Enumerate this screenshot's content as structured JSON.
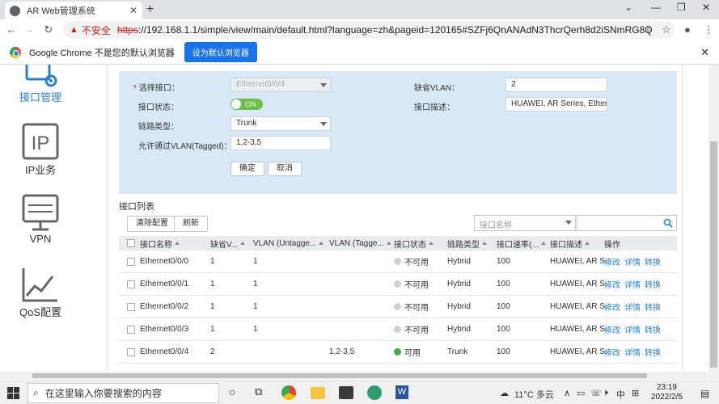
{
  "browser": {
    "tab_title": "AR Web管理系统",
    "insecure_label": "不安全",
    "url_scheme": "https",
    "url_rest": "://192.168.1.1/simple/view/main/default.html?language=zh&pageid=120165#SZFj6QnANAdN3ThcrQerh8d2iSNmRG8Q",
    "infobar_message": "Google Chrome 不是您的默认浏览器",
    "infobar_button": "设为默认浏览器"
  },
  "leftnav": {
    "items": [
      {
        "label": "接口管理",
        "icon": "interface-icon"
      },
      {
        "label": "IP业务",
        "icon": "ip-icon"
      },
      {
        "label": "VPN",
        "icon": "vpn-icon"
      },
      {
        "label": "QoS配置",
        "icon": "qos-icon"
      }
    ]
  },
  "form": {
    "interface_label": "选择接口：",
    "interface_value": "Ethernet0/0/4",
    "status_label": "接口状态：",
    "status_value": "ON",
    "link_type_label": "链路类型：",
    "link_type_value": "Trunk",
    "allowed_vlan_label": "允许通过VLAN(Tagged)：",
    "allowed_vlan_value": "1,2-3,5",
    "default_vlan_label": "缺省VLAN：",
    "default_vlan_value": "2",
    "description_label": "接口描述：",
    "description_value": "HUAWEI, AR Series, Ethernet",
    "ok_button": "确定",
    "cancel_button": "取消"
  },
  "list": {
    "title": "接口列表",
    "clear_button": "清除配置",
    "refresh_button": "刷新",
    "search_placeholder": "接口名称",
    "columns": [
      "接口名称",
      "缺省V...",
      "VLAN (Untagge...",
      "VLAN (Tagge...",
      "接口状态",
      "链路类型",
      "接口速率(...",
      "接口描述",
      "操作"
    ],
    "rows": [
      {
        "name": "Ethernet0/0/0",
        "default_vlan": "1",
        "untagged": "1",
        "tagged": "",
        "status": "不可用",
        "status_color": "#d0d0d0",
        "link_type": "Hybrid",
        "speed": "100",
        "desc": "HUAWEI, AR S..."
      },
      {
        "name": "Ethernet0/0/1",
        "default_vlan": "1",
        "untagged": "1",
        "tagged": "",
        "status": "不可用",
        "status_color": "#d0d0d0",
        "link_type": "Hybrid",
        "speed": "100",
        "desc": "HUAWEI, AR S..."
      },
      {
        "name": "Ethernet0/0/2",
        "default_vlan": "1",
        "untagged": "1",
        "tagged": "",
        "status": "不可用",
        "status_color": "#d0d0d0",
        "link_type": "Hybrid",
        "speed": "100",
        "desc": "HUAWEI, AR S..."
      },
      {
        "name": "Ethernet0/0/3",
        "default_vlan": "1",
        "untagged": "1",
        "tagged": "",
        "status": "不可用",
        "status_color": "#d0d0d0",
        "link_type": "Hybrid",
        "speed": "100",
        "desc": "HUAWEI, AR S..."
      },
      {
        "name": "Ethernet0/0/4",
        "default_vlan": "2",
        "untagged": "",
        "tagged": "1,2-3,5",
        "status": "可用",
        "status_color": "#3cb043",
        "link_type": "Trunk",
        "speed": "100",
        "desc": "HUAWEI, AR S..."
      }
    ],
    "actions": [
      "修改",
      "详情",
      "转换"
    ]
  },
  "taskbar": {
    "search_placeholder": "在这里输入你要搜索的内容",
    "weather": "11°C 多云",
    "time": "23:19",
    "date": "2022/2/5"
  },
  "colors": {
    "accent": "#2c82c9",
    "panel": "#d9e8f7",
    "toggle_on": "#6cbf4c"
  }
}
